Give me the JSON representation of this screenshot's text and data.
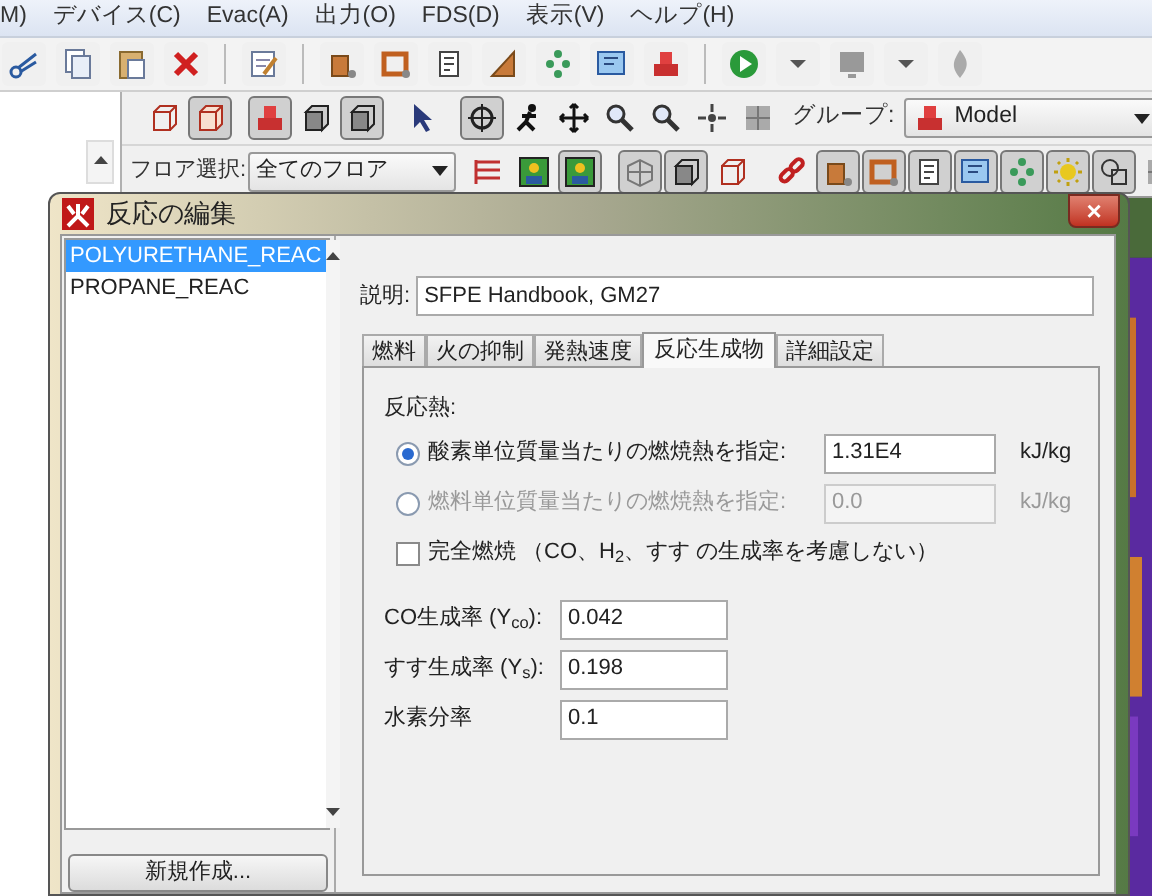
{
  "menu_bar": {
    "items": [
      "M)",
      "デバイス(C)",
      "Evac(A)",
      "出力(O)",
      "FDS(D)",
      "表示(V)",
      "ヘルプ(H)"
    ]
  },
  "main_toolbar": {
    "items": [
      {
        "kind": "scissors"
      },
      {
        "kind": "copy"
      },
      {
        "kind": "paste"
      },
      {
        "kind": "delete"
      },
      {
        "kind": "separator"
      },
      {
        "kind": "notepad"
      },
      {
        "kind": "separator"
      },
      {
        "kind": "block"
      },
      {
        "kind": "frame"
      },
      {
        "kind": "document"
      },
      {
        "kind": "wedge"
      },
      {
        "kind": "dots"
      },
      {
        "kind": "tag"
      },
      {
        "kind": "bricks"
      },
      {
        "kind": "separator"
      },
      {
        "kind": "play"
      },
      {
        "kind": "caret"
      },
      {
        "kind": "screen"
      },
      {
        "kind": "caret"
      },
      {
        "kind": "flame"
      }
    ]
  },
  "view_toolbar": {
    "items": [
      {
        "kind": "wire-box",
        "pressed": false
      },
      {
        "kind": "box",
        "pressed": true
      },
      {
        "kind": "separator"
      },
      {
        "kind": "bricks",
        "pressed": true
      },
      {
        "kind": "cube",
        "pressed": false
      },
      {
        "kind": "cube",
        "pressed": true
      },
      {
        "kind": "separator"
      },
      {
        "kind": "pointer",
        "pressed": false
      },
      {
        "kind": "separator"
      },
      {
        "kind": "orbit",
        "pressed": true
      },
      {
        "kind": "runner",
        "pressed": false
      },
      {
        "kind": "move",
        "pressed": false
      },
      {
        "kind": "zoom",
        "pressed": false
      },
      {
        "kind": "zoom",
        "pressed": false
      },
      {
        "kind": "crosshair",
        "pressed": false
      },
      {
        "kind": "grid",
        "pressed": false
      }
    ],
    "group_label": "グループ:",
    "group_value": "Model"
  },
  "floor_toolbar": {
    "floor_label": "フロア選択:",
    "floor_value": "全てのフロア",
    "items": [
      {
        "kind": "floor-plan",
        "pressed": false
      },
      {
        "kind": "picture-frame",
        "pressed": false
      },
      {
        "kind": "picture-frame",
        "pressed": true
      },
      {
        "kind": "separator"
      },
      {
        "kind": "wire-grid",
        "pressed": true
      },
      {
        "kind": "cube",
        "pressed": true
      },
      {
        "kind": "wire-box",
        "pressed": false
      },
      {
        "kind": "separator"
      },
      {
        "kind": "chain",
        "pressed": false
      },
      {
        "kind": "block",
        "pressed": true
      },
      {
        "kind": "frame",
        "pressed": true
      },
      {
        "kind": "document",
        "pressed": true
      },
      {
        "kind": "tag",
        "pressed": true
      },
      {
        "kind": "dots",
        "pressed": true
      },
      {
        "kind": "sun",
        "pressed": true
      },
      {
        "kind": "shapes",
        "pressed": true
      },
      {
        "kind": "grid",
        "pressed": false
      }
    ]
  },
  "dialog": {
    "title": "反応の編集",
    "close": "×",
    "reactions": [
      {
        "name": "POLYURETHANE_REAC",
        "selected": true
      },
      {
        "name": "PROPANE_REAC",
        "selected": false
      }
    ],
    "new_button": "新規作成...",
    "description_label": "説明:",
    "description": "SFPE Handbook, GM27",
    "tabs": [
      {
        "label": "燃料",
        "selected": false
      },
      {
        "label": "火の抑制",
        "selected": false
      },
      {
        "label": "発熱速度",
        "selected": false
      },
      {
        "label": "反応生成物",
        "selected": true
      },
      {
        "label": "詳細設定",
        "selected": false
      }
    ],
    "heat_label": "反応熱:",
    "heat_options": [
      {
        "label": "酸素単位質量当たりの燃焼熱を指定:",
        "value": "1.31E4",
        "unit": "kJ/kg",
        "selected": true
      },
      {
        "label": "燃料単位質量当たりの燃焼熱を指定:",
        "value": "0.0",
        "unit": "kJ/kg",
        "selected": false
      }
    ],
    "complete_combustion": {
      "label": "完全燃焼 （CO、H$_{2}$、すす の生成率を考慮しない）",
      "checked": false
    },
    "fields": [
      {
        "label": "CO生成率 (Y$_{co}$):",
        "value": "0.042"
      },
      {
        "label": "すす生成率 (Y$_{s}$):",
        "value": "0.198"
      },
      {
        "label": "水素分率",
        "value": "0.1"
      }
    ]
  }
}
